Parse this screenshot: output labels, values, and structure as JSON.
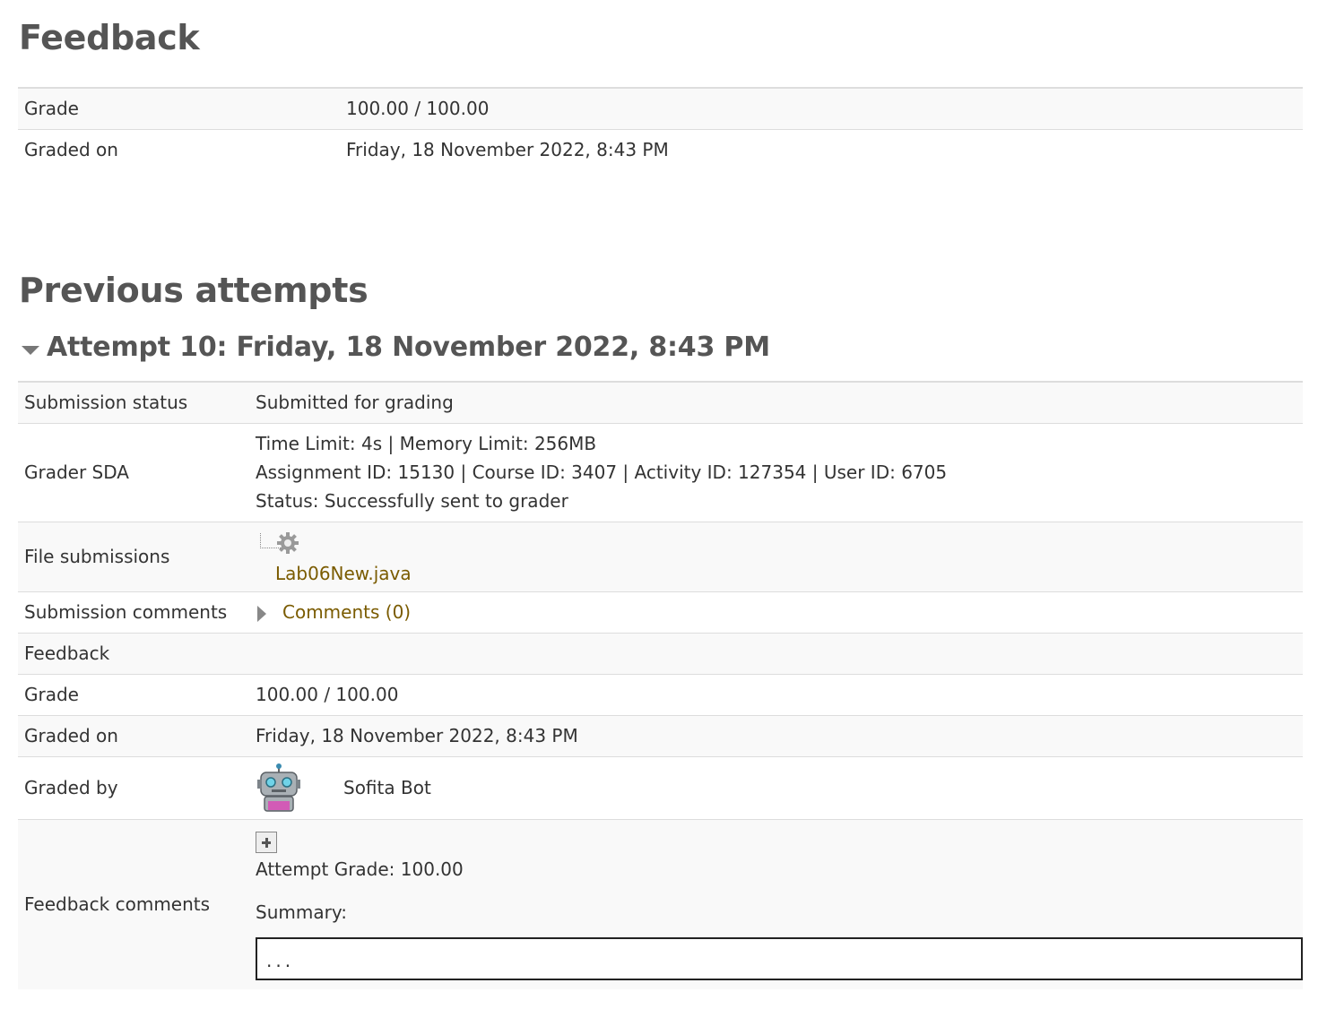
{
  "feedback": {
    "heading": "Feedback",
    "rows": [
      {
        "label": "Grade",
        "value": "100.00 / 100.00"
      },
      {
        "label": "Graded on",
        "value": "Friday, 18 November 2022, 8:43 PM"
      }
    ]
  },
  "previous": {
    "heading": "Previous attempts",
    "attempt_title": "Attempt 10: Friday, 18 November 2022, 8:43 PM",
    "submission_status": {
      "label": "Submission status",
      "value": "Submitted for grading"
    },
    "grader": {
      "label": "Grader SDA",
      "line1": "Time Limit: 4s | Memory Limit: 256MB",
      "line2": "Assignment ID: 15130 | Course ID: 3407 | Activity ID: 127354 | User ID: 6705",
      "line3": "Status: Successfully sent to grader"
    },
    "files": {
      "label": "File submissions",
      "file_name": "Lab06New.java"
    },
    "comments": {
      "label": "Submission comments",
      "link": "Comments (0)"
    },
    "feedback_label": "Feedback",
    "grade": {
      "label": "Grade",
      "value": "100.00 / 100.00"
    },
    "graded_on": {
      "label": "Graded on",
      "value": "Friday, 18 November 2022, 8:43 PM"
    },
    "graded_by": {
      "label": "Graded by",
      "name": "Sofita Bot"
    },
    "feedback_comments": {
      "label": "Feedback comments",
      "attempt_grade": "Attempt Grade: 100.00",
      "summary_label": "Summary:",
      "summary_value": "..."
    }
  }
}
